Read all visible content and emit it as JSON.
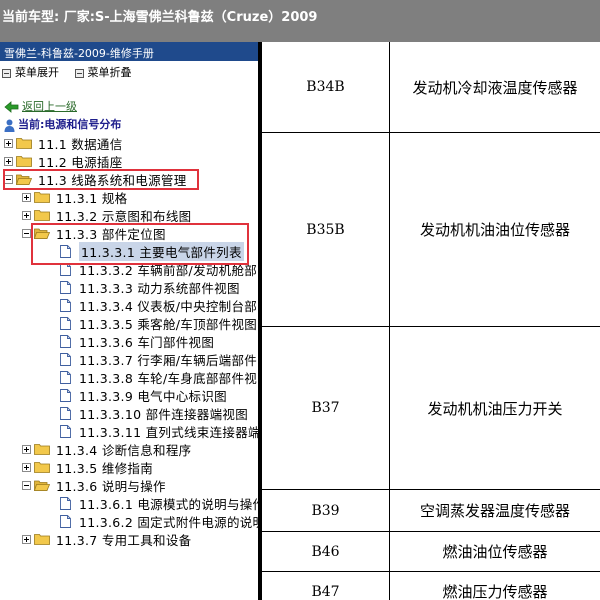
{
  "header": {
    "vehicle_line": "当前车型:  厂家:S-上海雪佛兰科鲁兹（Cruze）2009"
  },
  "sidebar": {
    "title": "雪佛兰-科鲁兹-2009-维修手册",
    "expand_all": "菜单展开",
    "collapse_all": "菜单折叠",
    "back_link": "返回上一级",
    "current": "当前:电源和信号分布"
  },
  "tree": [
    {
      "label": "11.1 数据通信",
      "kind": "folder",
      "expander": "plus",
      "level": 0
    },
    {
      "label": "11.2 电源插座",
      "kind": "folder",
      "expander": "plus",
      "level": 0
    },
    {
      "label": "11.3 线路系统和电源管理",
      "kind": "folder-open",
      "expander": "minus",
      "level": 0
    },
    {
      "label": "11.3.1 规格",
      "kind": "folder",
      "expander": "plus",
      "level": 1
    },
    {
      "label": "11.3.2 示意图和布线图",
      "kind": "folder",
      "expander": "plus",
      "level": 1
    },
    {
      "label": "11.3.3 部件定位图",
      "kind": "folder-open",
      "expander": "minus",
      "level": 1
    },
    {
      "label": "11.3.3.1 主要电气部件列表",
      "kind": "doc",
      "level": 2,
      "selected": true
    },
    {
      "label": "11.3.3.2 车辆前部/发动机舱部",
      "kind": "doc",
      "level": 2
    },
    {
      "label": "11.3.3.3 动力系统部件视图",
      "kind": "doc",
      "level": 2
    },
    {
      "label": "11.3.3.4 仪表板/中央控制台部",
      "kind": "doc",
      "level": 2
    },
    {
      "label": "11.3.3.5 乘客舱/车顶部件视图",
      "kind": "doc",
      "level": 2
    },
    {
      "label": "11.3.3.6 车门部件视图",
      "kind": "doc",
      "level": 2
    },
    {
      "label": "11.3.3.7 行李厢/车辆后端部件",
      "kind": "doc",
      "level": 2
    },
    {
      "label": "11.3.3.8 车轮/车身底部部件视",
      "kind": "doc",
      "level": 2
    },
    {
      "label": "11.3.3.9 电气中心标识图",
      "kind": "doc",
      "level": 2
    },
    {
      "label": "11.3.3.10 部件连接器端视图",
      "kind": "doc",
      "level": 2
    },
    {
      "label": "11.3.3.11 直列式线束连接器端",
      "kind": "doc",
      "level": 2
    },
    {
      "label": "11.3.4 诊断信息和程序",
      "kind": "folder",
      "expander": "plus",
      "level": 1
    },
    {
      "label": "11.3.5 维修指南",
      "kind": "folder",
      "expander": "plus",
      "level": 1
    },
    {
      "label": "11.3.6 说明与操作",
      "kind": "folder-open",
      "expander": "minus",
      "level": 1
    },
    {
      "label": "11.3.6.1 电源模式的说明与操作",
      "kind": "doc",
      "level": 2
    },
    {
      "label": "11.3.6.2 固定式附件电源的说明",
      "kind": "doc",
      "level": 2
    },
    {
      "label": "11.3.7 专用工具和设备",
      "kind": "folder",
      "expander": "plus",
      "level": 1
    }
  ],
  "table": {
    "rows": [
      {
        "code": "B34B",
        "desc": "发动机冷却液温度传感器"
      },
      {
        "code": "B35B",
        "desc": "发动机机油油位传感器"
      },
      {
        "code": "B37",
        "desc": "发动机机油压力开关"
      },
      {
        "code": "B39",
        "desc": "空调蒸发器温度传感器"
      },
      {
        "code": "B46",
        "desc": "燃油油位传感器"
      },
      {
        "code": "B47",
        "desc": "燃油压力传感器"
      }
    ]
  },
  "colors": {
    "highlight_border": "#e0323c",
    "sidebar_title_bg": "#1f4a8c",
    "topbar_bg": "#7f7f7f",
    "folder": "#f2c84b"
  },
  "icons": {
    "back": "back-arrow-icon",
    "current": "person-icon",
    "folder": "folder-icon",
    "folder_open": "folder-open-icon",
    "document": "document-icon"
  }
}
